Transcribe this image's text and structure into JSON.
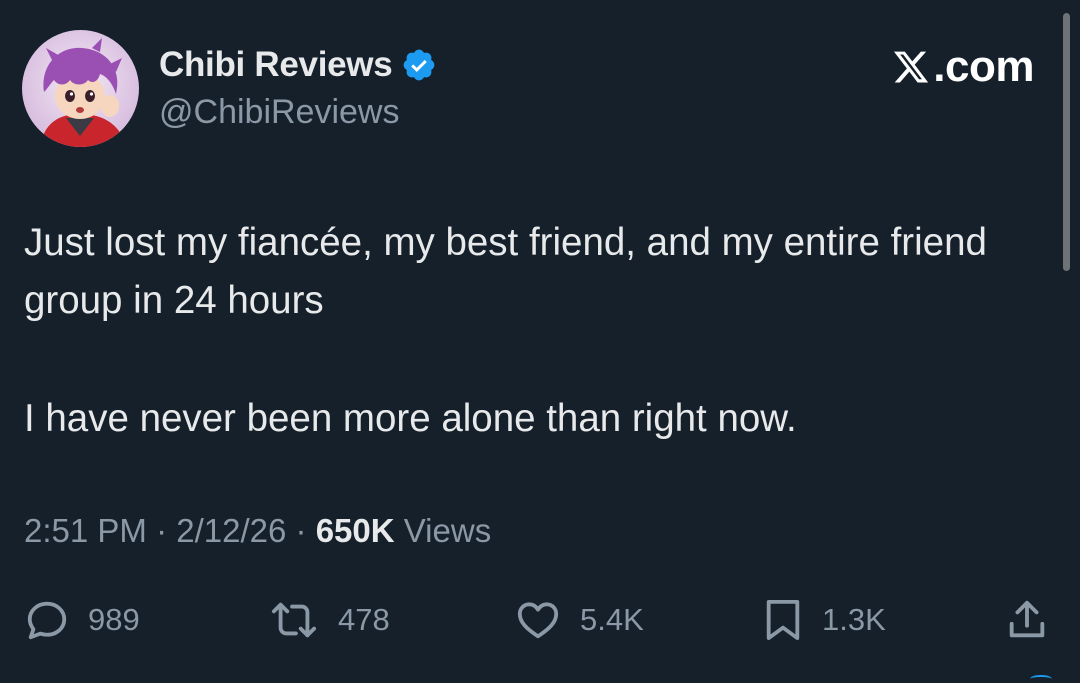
{
  "author": {
    "display_name": "Chibi Reviews",
    "handle": "@ChibiReviews",
    "verified": true,
    "avatar_icon": "chibi-character-avatar"
  },
  "brand": {
    "label": ".com",
    "icon": "x-logo-icon"
  },
  "tweet": {
    "line1": "Just lost my fiancée, my best friend, and my entire friend group in 24 hours",
    "line2": "I have never been more alone than right now."
  },
  "meta": {
    "time": "2:51 PM",
    "date": "2/12/26",
    "separator": "·",
    "views_count": "650K",
    "views_label": "Views"
  },
  "actions": {
    "replies": "989",
    "reposts": "478",
    "likes": "5.4K",
    "bookmarks": "1.3K"
  },
  "colors": {
    "background": "#15202b",
    "primary_text": "#e7e9ea",
    "secondary_text": "#8b98a5",
    "verified_badge": "#1d9bf0",
    "scrollbar": "#6e7378"
  }
}
